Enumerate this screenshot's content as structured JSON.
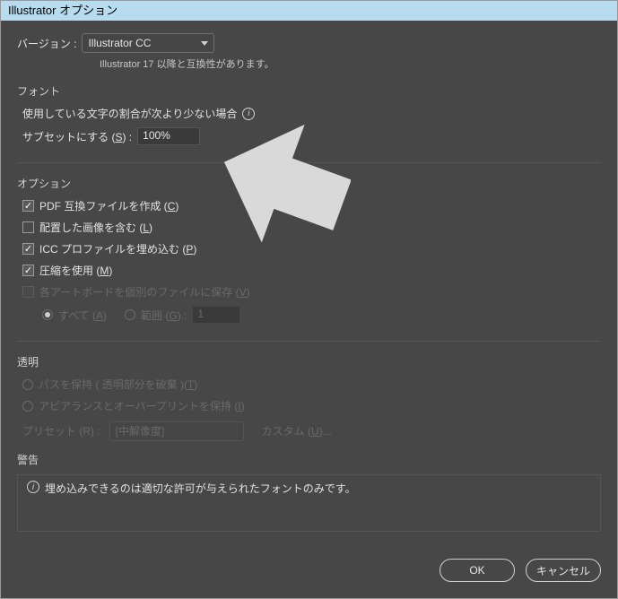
{
  "title": "Illustrator オプション",
  "version": {
    "label": "バージョン :",
    "value": "Illustrator CC",
    "hint": "Illustrator 17 以降と互換性があります。"
  },
  "font_group": {
    "title": "フォント",
    "subset_pre": "使用している文字の割合が次より少ない場合",
    "subset_label_pre": "サブセットにする (",
    "subset_hot": "S",
    "subset_label_post": ") :",
    "subset_value": "100%"
  },
  "options_group": {
    "title": "オプション",
    "pdf": {
      "checked": true,
      "pre": "PDF 互換ファイルを作成 (",
      "hot": "C",
      "post": ")"
    },
    "link": {
      "checked": false,
      "pre": "配置した画像を含む (",
      "hot": "L",
      "post": ")"
    },
    "icc": {
      "checked": true,
      "pre": "ICC プロファイルを埋め込む (",
      "hot": "P",
      "post": ")"
    },
    "compress": {
      "checked": true,
      "pre": "圧縮を使用 (",
      "hot": "M",
      "post": ")"
    },
    "artboards": {
      "checked": false,
      "disabled": true,
      "pre": "各アートボードを個別のファイルに保存 (",
      "hot": "V",
      "post": ")"
    },
    "range": {
      "all_pre": "すべて (",
      "all_hot": "A",
      "all_post": ")",
      "range_pre": "範囲 (",
      "range_hot": "G",
      "range_post": ") :",
      "value": "1"
    }
  },
  "transparency_group": {
    "title": "透明",
    "preserve": {
      "pre": "パスを保持 ( 透明部分を破棄 )(",
      "hot": "T",
      "post": ")"
    },
    "appearance": {
      "pre": "アピアランスとオーバープリントを保持 (",
      "hot": "I",
      "post": ")"
    },
    "preset_label_pre": "プリセット (R) :",
    "preset_value": "[中解像度]",
    "custom_pre": "カスタム (",
    "custom_hot": "U",
    "custom_post": ")..."
  },
  "warning": {
    "title": "警告",
    "text": "埋め込みできるのは適切な許可が与えられたフォントのみです。"
  },
  "buttons": {
    "ok": "OK",
    "cancel": "キャンセル"
  }
}
